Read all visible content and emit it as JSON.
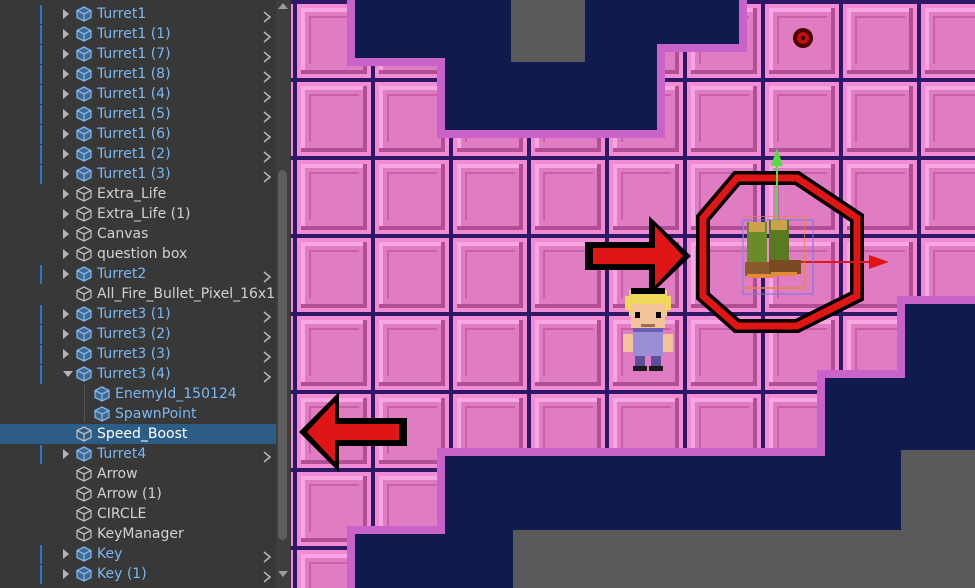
{
  "hierarchy": {
    "items": [
      {
        "label": "Turret1",
        "prefab": true,
        "has_children": true
      },
      {
        "label": "Turret1 (1)",
        "prefab": true,
        "has_children": true
      },
      {
        "label": "Turret1 (7)",
        "prefab": true,
        "has_children": true
      },
      {
        "label": "Turret1 (8)",
        "prefab": true,
        "has_children": true
      },
      {
        "label": "Turret1 (4)",
        "prefab": true,
        "has_children": true
      },
      {
        "label": "Turret1 (5)",
        "prefab": true,
        "has_children": true
      },
      {
        "label": "Turret1 (6)",
        "prefab": true,
        "has_children": true
      },
      {
        "label": "Turret1 (2)",
        "prefab": true,
        "has_children": true
      },
      {
        "label": "Turret1 (3)",
        "prefab": true,
        "has_children": true
      },
      {
        "label": "Extra_Life",
        "prefab": false,
        "has_children": true
      },
      {
        "label": "Extra_Life (1)",
        "prefab": false,
        "has_children": true
      },
      {
        "label": "Canvas",
        "prefab": false,
        "has_children": true
      },
      {
        "label": "question box",
        "prefab": false,
        "has_children": true
      },
      {
        "label": "Turret2",
        "prefab": true,
        "has_children": true
      },
      {
        "label": "All_Fire_Bullet_Pixel_16x1",
        "prefab": false,
        "has_children": false
      },
      {
        "label": "Turret3 (1)",
        "prefab": true,
        "has_children": true
      },
      {
        "label": "Turret3 (2)",
        "prefab": true,
        "has_children": true
      },
      {
        "label": "Turret3 (3)",
        "prefab": true,
        "has_children": true
      },
      {
        "label": "Turret3 (4)",
        "prefab": true,
        "has_children": true,
        "expanded": true
      },
      {
        "label": "EnemyId_150124",
        "prefab": true,
        "has_children": false,
        "indent": 1
      },
      {
        "label": "SpawnPoint",
        "prefab": true,
        "has_children": false,
        "indent": 1
      },
      {
        "label": "Speed_Boost",
        "prefab": false,
        "has_children": false,
        "selected": true
      },
      {
        "label": "Turret4",
        "prefab": true,
        "has_children": true
      },
      {
        "label": "Arrow",
        "prefab": false,
        "has_children": false
      },
      {
        "label": "Arrow (1)",
        "prefab": false,
        "has_children": false
      },
      {
        "label": "CIRCLE",
        "prefab": false,
        "has_children": false
      },
      {
        "label": "KeyManager",
        "prefab": false,
        "has_children": false
      },
      {
        "label": "Key",
        "prefab": true,
        "has_children": true
      },
      {
        "label": "Key (1)",
        "prefab": true,
        "has_children": true
      }
    ]
  },
  "icons": {
    "foldout": "triangle-right-icon",
    "expanded_foldout": "triangle-down-icon",
    "game_object": "cube-icon",
    "prefab_arrow": "chevron-right-icon",
    "scene_hero": "character-sprite",
    "scene_pickup": "speed-boots-sprite",
    "gizmo": "move-tool-gizmo-icon"
  },
  "colors": {
    "panel_bg": "#383838",
    "selected_row": "#2c5d87",
    "prefab_text": "#7bb8f2",
    "text": "#d2d2d2",
    "floor_tile": "#e07cc2",
    "wall": "#c963c9",
    "water": "#0f1a4e",
    "arrow_red": "#e01616",
    "circle_red": "#e01616"
  }
}
